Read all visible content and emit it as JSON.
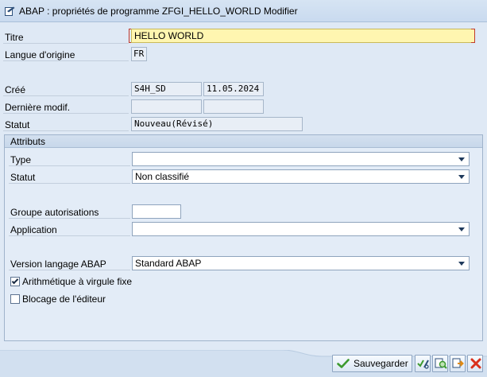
{
  "window": {
    "title": "ABAP : propriétés de programme ZFGI_HELLO_WORLD Modifier"
  },
  "header": {
    "titre_label": "Titre",
    "titre_value": "HELLO WORLD",
    "langue_label": "Langue d'origine",
    "langue_value": "FR",
    "cree_label": "Créé",
    "cree_user": "S4H_SD",
    "cree_date": "11.05.2024",
    "derniere_modif_label": "Dernière modif.",
    "derniere_modif_user": "",
    "derniere_modif_date": "",
    "statut_label": "Statut",
    "statut_value": "Nouveau(Révisé)"
  },
  "attributs": {
    "group_title": "Attributs",
    "type_label": "Type",
    "type_value": "",
    "statut_label": "Statut",
    "statut_value": "Non classifié",
    "groupe_autorisations_label": "Groupe autorisations",
    "groupe_autorisations_value": "",
    "application_label": "Application",
    "application_value": "",
    "version_label": "Version langage ABAP",
    "version_value": "Standard ABAP",
    "arith_label": "Arithmétique à virgule fixe",
    "arith_checked": true,
    "blocage_label": "Blocage de l'éditeur",
    "blocage_checked": false
  },
  "footer": {
    "save_label": "Sauvegarder",
    "icons": [
      "check-syntax-icon",
      "where-used-icon",
      "transfer-icon",
      "cancel-icon"
    ]
  },
  "colors": {
    "title_bar": "#c9daef",
    "background": "#dfe9f5",
    "required_field": "#fff6b0",
    "cancel_red": "#d9301c",
    "confirm_green": "#3d9a2f"
  }
}
